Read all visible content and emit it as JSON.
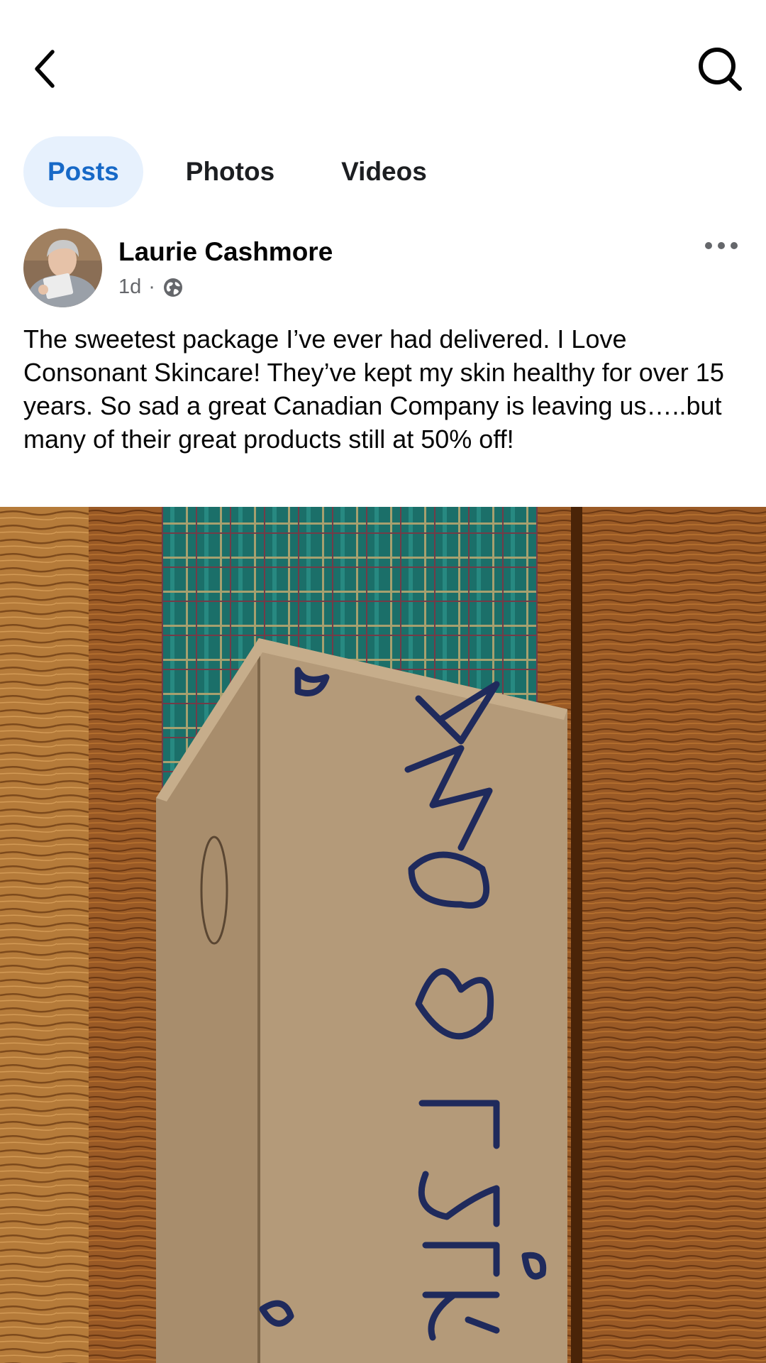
{
  "tabs": [
    {
      "label": "Posts",
      "active": true
    },
    {
      "label": "Photos",
      "active": false
    },
    {
      "label": "Videos",
      "active": false
    }
  ],
  "post": {
    "author": "Laurie Cashmore",
    "time": "1d",
    "separator": "·",
    "privacy_icon": "globe-icon",
    "text": "The sweetest package I’ve ever had delivered. I Love Consonant Skincare! They’ve kept my skin healthy for over 15 years. So sad a great Canadian Company is leaving us…..but many of their great products still at 50% off!",
    "photo": {
      "box_text": "We ♡ Laurie"
    }
  },
  "icons": {
    "back": "chevron-left-icon",
    "search": "search-icon",
    "more": "more-dots-icon"
  },
  "colors": {
    "accent": "#1769c7",
    "tab_active_bg": "#e7f1fd",
    "meta_text": "#65676b"
  }
}
